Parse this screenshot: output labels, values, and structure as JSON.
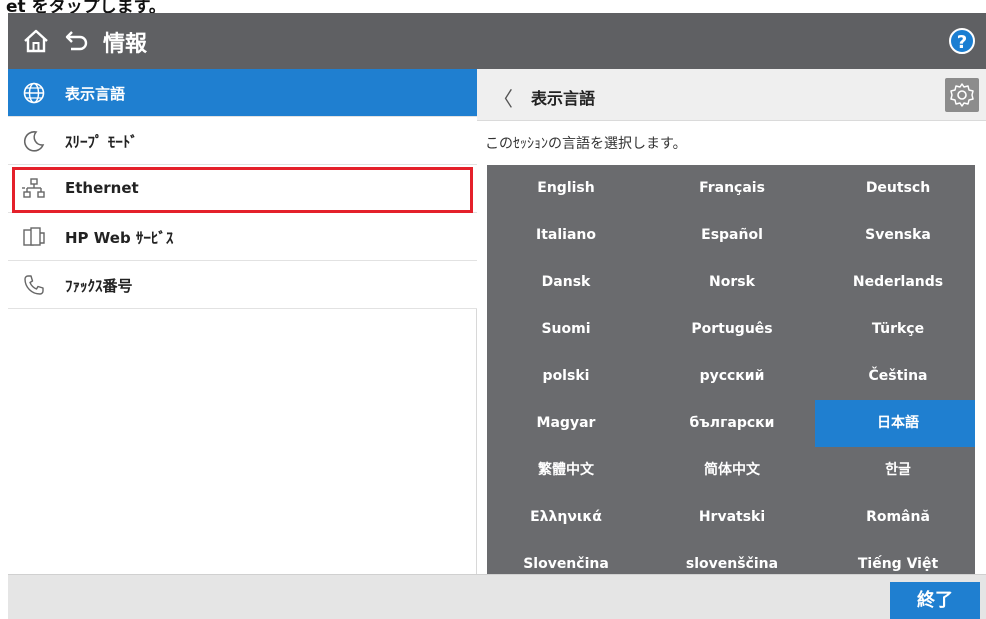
{
  "caption": {
    "text": "et をタップします。"
  },
  "topbar": {
    "title": "情報",
    "help_label": "?"
  },
  "menu": {
    "items": [
      {
        "label": "表示言語",
        "icon": "globe-icon",
        "selected": true
      },
      {
        "label": "ｽﾘｰﾌﾟ ﾓｰﾄﾞ",
        "icon": "moon-icon",
        "selected": false
      },
      {
        "label": "Ethernet",
        "icon": "network-icon",
        "selected": false
      },
      {
        "label": "HP Web ｻｰﾋﾞｽ",
        "icon": "web-services-icon",
        "selected": false
      },
      {
        "label": "ﾌｧｯｸｽ番号",
        "icon": "phone-icon",
        "selected": false
      }
    ]
  },
  "detail": {
    "back_glyph": "〈",
    "title": "表示言語",
    "description": "このｾｯｼｮﾝの言語を選択します。",
    "languages": [
      "English",
      "Français",
      "Deutsch",
      "Italiano",
      "Español",
      "Svenska",
      "Dansk",
      "Norsk",
      "Nederlands",
      "Suomi",
      "Português",
      "Türkçe",
      "polski",
      "русский",
      "Čeština",
      "Magyar",
      "български",
      "日本語",
      "繁體中文",
      "简体中文",
      "한글",
      "Ελληνικά",
      "Hrvatski",
      "Română",
      "Slovenčina",
      "slovenščina",
      "Tiếng Việt"
    ],
    "selected_language": "日本語"
  },
  "footer": {
    "done_label": "終了"
  },
  "colors": {
    "topbar": "#5f6063",
    "accent": "#1f7fd0",
    "grid": "#6a6b6e",
    "highlight": "#e4202a"
  }
}
